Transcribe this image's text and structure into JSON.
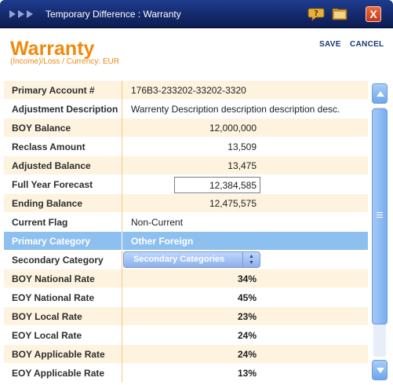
{
  "window": {
    "title": "Temporary Difference : Warranty",
    "close_label": "X",
    "icons": [
      "help-icon",
      "folder-icon",
      "close-icon"
    ]
  },
  "header": {
    "title": "Warranty",
    "subtitle": "(Income)/Loss  /  Currency: EUR",
    "save_label": "SAVE",
    "cancel_label": "CANCEL"
  },
  "colors": {
    "accent": "#f08a0e",
    "titlebar": "#13286a",
    "selected_row": "#8ec0ef",
    "row_alt": "#fdf3df"
  },
  "rows": [
    {
      "label": "Primary Account #",
      "value": "176B3-233202-33202-3320"
    },
    {
      "label": "Adjustment Description",
      "value": "Warrenty Description description description desc."
    },
    {
      "label": "BOY Balance",
      "value": "12,000,000"
    },
    {
      "label": "Reclass Amount",
      "value": "13,509"
    },
    {
      "label": "Adjusted Balance",
      "value": "13,475"
    },
    {
      "label": "Full Year Forecast",
      "value": "12,384,585"
    },
    {
      "label": "Ending Balance",
      "value": "12,475,575"
    },
    {
      "label": "Current Flag",
      "value": "Non-Current"
    },
    {
      "label": "Primary Category",
      "value": "Other Foreign"
    },
    {
      "label": "Secondary Category",
      "value": "Secondary Categories"
    },
    {
      "label": "BOY National Rate",
      "value": "34%"
    },
    {
      "label": "EOY National Rate",
      "value": "45%"
    },
    {
      "label": "BOY Local Rate",
      "value": "23%"
    },
    {
      "label": "EOY Local Rate",
      "value": "24%"
    },
    {
      "label": "BOY Applicable Rate",
      "value": "24%"
    },
    {
      "label": "EOY Applicable Rate",
      "value": "13%"
    }
  ]
}
